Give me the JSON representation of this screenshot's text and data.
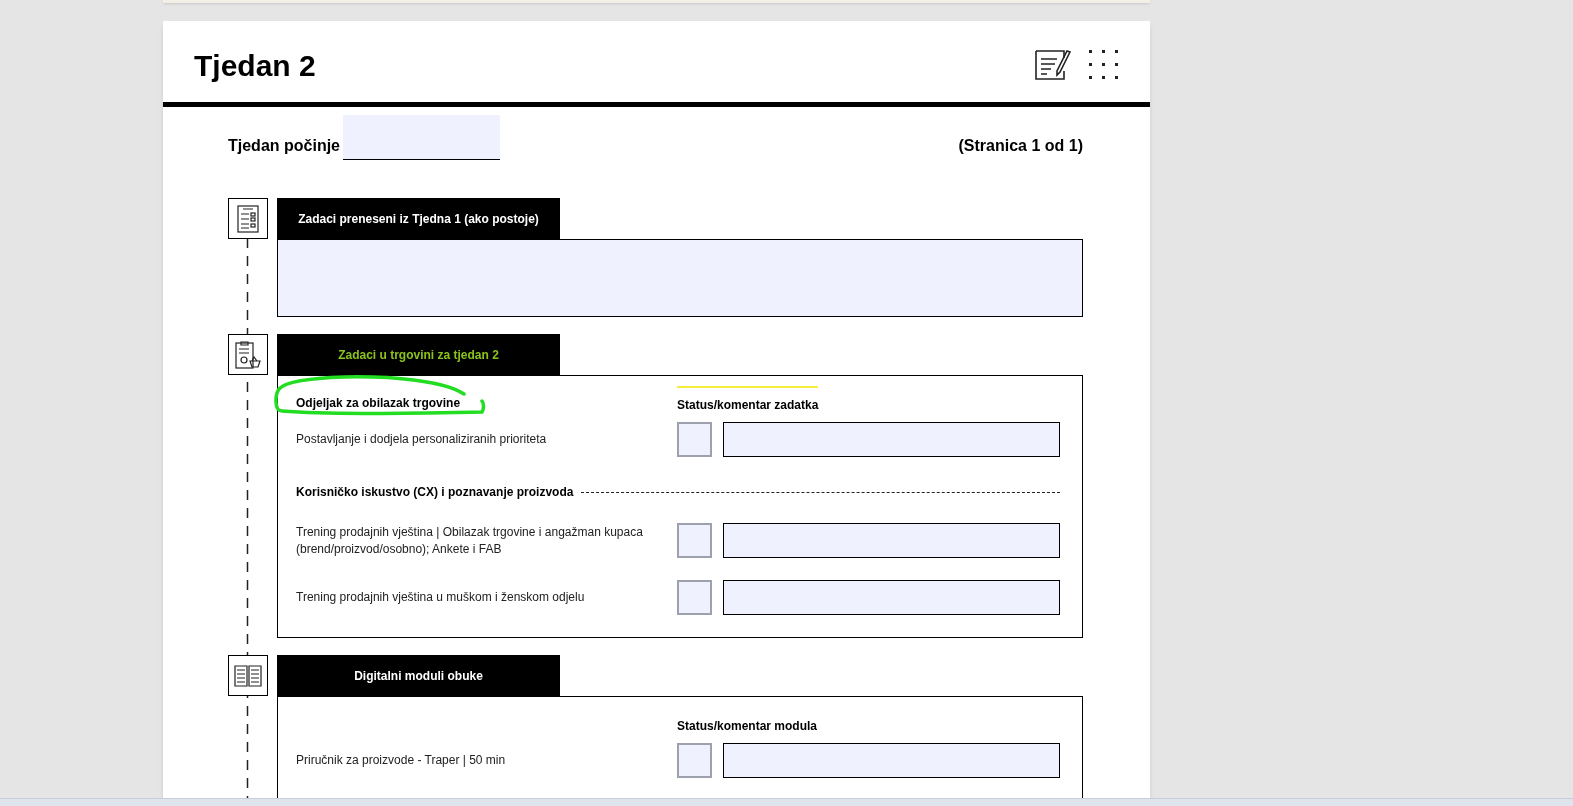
{
  "document": {
    "title": "Tjedan 2",
    "week_start_label": "Tjedan počinje",
    "page_number": "(Stranica 1 od 1)"
  },
  "sections": [
    {
      "kind": "note",
      "title": "Zadaci preneseni iz Tjedna 1 (ako postoje)",
      "color": "#ffffff"
    },
    {
      "kind": "tasks",
      "title": "Zadaci u trgovini za tjedan 2",
      "color": "#8cc21c",
      "heading": "Odjeljak za obilazak trgovine",
      "heading_circled": true,
      "status_label": "Status/komentar zadatka",
      "status_marked": true,
      "items": [
        {
          "kind": "task",
          "text": "Postavljanje i dodjela personaliziranih prioriteta",
          "checked": false
        },
        {
          "kind": "subheading",
          "text": "Korisničko iskustvo (CX) i poznavanje proizvoda"
        },
        {
          "kind": "task",
          "text": "Trening prodajnih vještina | Obilazak trgovine i angažman kupaca (brend/proizvod/osobno); Ankete i FAB",
          "checked": false
        },
        {
          "kind": "task",
          "text": "Trening prodajnih vještina u muškom i ženskom odjelu",
          "checked": false
        }
      ]
    },
    {
      "kind": "tasks",
      "title": "Digitalni moduli obuke",
      "color": "#ffffff",
      "status_label": "Status/komentar modula",
      "status_marked": false,
      "items": [
        {
          "kind": "task",
          "text": "Priručnik za proizvode - Traper | 50 min",
          "checked": false
        }
      ]
    }
  ]
}
